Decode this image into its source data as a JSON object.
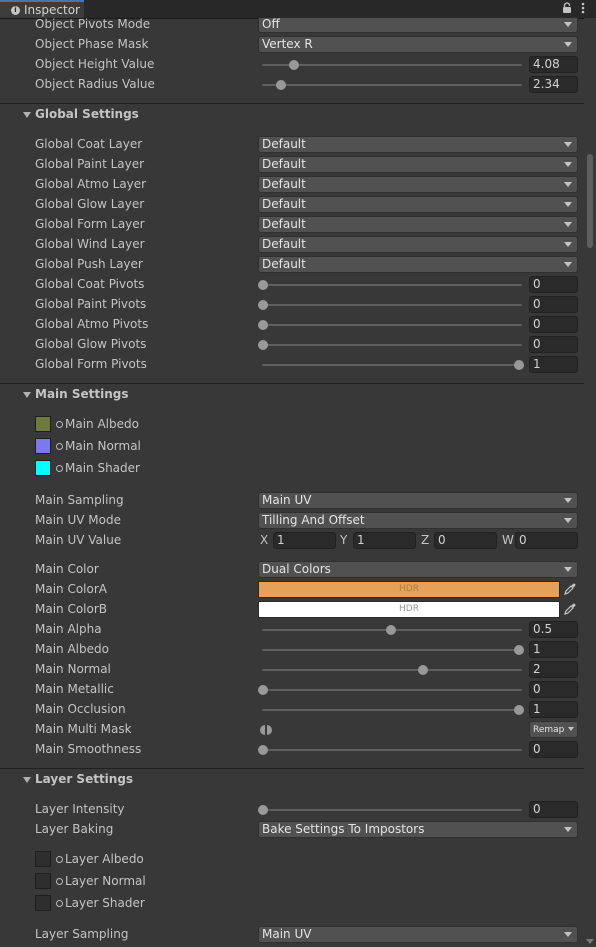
{
  "window": {
    "tab_title": "Inspector",
    "tab_icon": "info-icon"
  },
  "object_rows": [
    {
      "label": "Object Pivots Mode",
      "dropdown": "Off"
    },
    {
      "label": "Object Phase Mask",
      "dropdown": "Vertex R"
    },
    {
      "label": "Object Height Value",
      "value": "4.08",
      "fraction": 0.12
    },
    {
      "label": "Object Radius Value",
      "value": "2.34",
      "fraction": 0.07
    }
  ],
  "global_settings": {
    "title": "Global Settings",
    "layers": [
      {
        "label": "Global Coat Layer",
        "dropdown": "Default"
      },
      {
        "label": "Global Paint Layer",
        "dropdown": "Default"
      },
      {
        "label": "Global Atmo Layer",
        "dropdown": "Default"
      },
      {
        "label": "Global Glow Layer",
        "dropdown": "Default"
      },
      {
        "label": "Global Form Layer",
        "dropdown": "Default"
      },
      {
        "label": "Global Wind Layer",
        "dropdown": "Default"
      },
      {
        "label": "Global Push Layer",
        "dropdown": "Default"
      }
    ],
    "pivots": [
      {
        "label": "Global Coat Pivots",
        "value": "0",
        "fraction": 0
      },
      {
        "label": "Global Paint Pivots",
        "value": "0",
        "fraction": 0
      },
      {
        "label": "Global Atmo Pivots",
        "value": "0",
        "fraction": 0
      },
      {
        "label": "Global Glow Pivots",
        "value": "0",
        "fraction": 0
      },
      {
        "label": "Global Form Pivots",
        "value": "1",
        "fraction": 1
      }
    ]
  },
  "main_settings": {
    "title": "Main Settings",
    "textures": [
      {
        "label": "Main Albedo",
        "color": "#6e7a3a"
      },
      {
        "label": "Main Normal",
        "color": "#7a7aee"
      },
      {
        "label": "Main Shader",
        "color": "#00ffff"
      }
    ],
    "sampling": {
      "label": "Main Sampling",
      "dropdown": "Main UV"
    },
    "uv_mode": {
      "label": "Main UV Mode",
      "dropdown": "Tilling And Offset"
    },
    "uv_value": {
      "label": "Main UV Value",
      "x_label": "X",
      "x": "1",
      "y_label": "Y",
      "y": "1",
      "z_label": "Z",
      "z": "0",
      "w_label": "W",
      "w": "0"
    },
    "color": {
      "label": "Main Color",
      "dropdown": "Dual Colors"
    },
    "color_a": {
      "label": "Main ColorA",
      "hdr": "HDR",
      "color": "#e3a15a"
    },
    "color_b": {
      "label": "Main ColorB",
      "hdr": "HDR",
      "color": "#ffffff"
    },
    "sliders": [
      {
        "label": "Main Alpha",
        "value": "0.5",
        "fraction": 0.5
      },
      {
        "label": "Main Albedo",
        "value": "1",
        "fraction": 1
      },
      {
        "label": "Main Normal",
        "value": "2",
        "fraction": 0.625
      },
      {
        "label": "Main Metallic",
        "value": "0",
        "fraction": 0
      },
      {
        "label": "Main Occlusion",
        "value": "1",
        "fraction": 1
      }
    ],
    "multi_mask": {
      "label": "Main Multi Mask",
      "dropdown": "Remap"
    },
    "smoothness": {
      "label": "Main Smoothness",
      "value": "0",
      "fraction": 0
    }
  },
  "layer_settings": {
    "title": "Layer Settings",
    "intensity": {
      "label": "Layer Intensity",
      "value": "0",
      "fraction": 0
    },
    "baking": {
      "label": "Layer Baking",
      "dropdown": "Bake Settings To Impostors"
    },
    "textures": [
      {
        "label": "Layer Albedo"
      },
      {
        "label": "Layer Normal"
      },
      {
        "label": "Layer Shader"
      }
    ],
    "sampling": {
      "label": "Layer Sampling",
      "dropdown": "Main UV"
    }
  },
  "colors": {
    "background": "#383838",
    "field_dark": "#2a2a2a",
    "dropdown": "#515151",
    "accent": "#3a79bb"
  }
}
